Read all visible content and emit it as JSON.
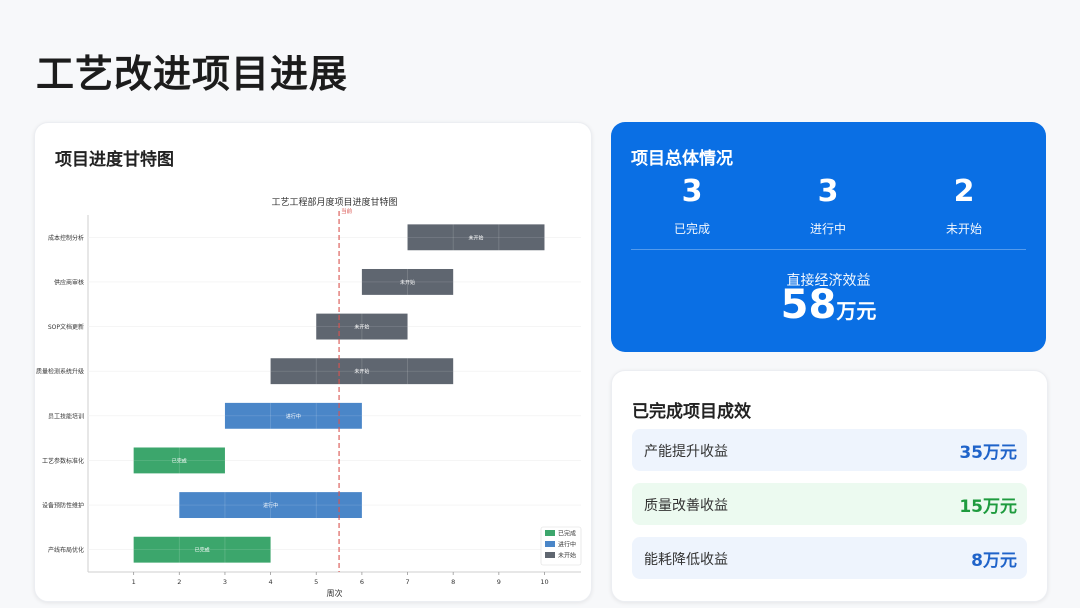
{
  "page": {
    "title": "工艺改进项目进展"
  },
  "gantt_card": {
    "title": "项目进度甘特图"
  },
  "chart_data": {
    "type": "gantt",
    "title": "工艺工程部月度项目进度甘特图",
    "xlabel": "周次",
    "xlim": [
      0,
      10.8
    ],
    "xticks": [
      1,
      2,
      3,
      4,
      5,
      6,
      7,
      8,
      9,
      10
    ],
    "today": {
      "x": 5.5,
      "label": "当前"
    },
    "statuses": [
      {
        "name": "已完成",
        "color": "#3ca66c"
      },
      {
        "name": "进行中",
        "color": "#4a86c8"
      },
      {
        "name": "未开始",
        "color": "#5f6670"
      }
    ],
    "tasks": [
      {
        "name": "成本控制分析",
        "start": 7,
        "end": 10,
        "status": "未开始"
      },
      {
        "name": "供应商审核",
        "start": 6,
        "end": 8,
        "status": "未开始"
      },
      {
        "name": "SOP文档更新",
        "start": 5,
        "end": 7,
        "status": "未开始"
      },
      {
        "name": "质量检测系统升级",
        "start": 4,
        "end": 8,
        "status": "未开始"
      },
      {
        "name": "员工技能培训",
        "start": 3,
        "end": 6,
        "status": "进行中"
      },
      {
        "name": "工艺参数标准化",
        "start": 1,
        "end": 3,
        "status": "已完成"
      },
      {
        "name": "设备预防性维护",
        "start": 2,
        "end": 6,
        "status": "进行中"
      },
      {
        "name": "产线布局优化",
        "start": 1,
        "end": 4,
        "status": "已完成"
      }
    ]
  },
  "summary": {
    "title": "项目总体情况",
    "stats": [
      {
        "value": "3",
        "label": "已完成"
      },
      {
        "value": "3",
        "label": "进行中"
      },
      {
        "value": "2",
        "label": "未开始"
      }
    ],
    "benefit_label": "直接经济效益",
    "benefit_value": "58",
    "benefit_unit": "万元"
  },
  "results": {
    "title": "已完成项目成效",
    "items": [
      {
        "label": "产能提升收益",
        "value": "35万元",
        "color": "#1f63c9",
        "bg": "#eef4fd"
      },
      {
        "label": "质量改善收益",
        "value": "15万元",
        "color": "#1e9b3e",
        "bg": "#ecfaf0"
      },
      {
        "label": "能耗降低收益",
        "value": "8万元",
        "color": "#1f63c9",
        "bg": "#eef4fd"
      }
    ]
  }
}
